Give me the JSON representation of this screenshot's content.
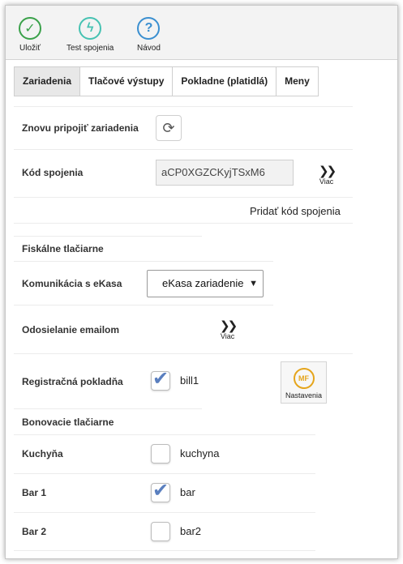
{
  "toolbar": {
    "save_label": "Uložiť",
    "test_label": "Test spojenia",
    "help_label": "Návod"
  },
  "tabs": [
    {
      "label": "Zariadenia",
      "active": true
    },
    {
      "label": "Tlačové výstupy",
      "active": false
    },
    {
      "label": "Pokladne (platidlá)",
      "active": false
    },
    {
      "label": "Meny",
      "active": false
    }
  ],
  "devices": {
    "reconnect_label": "Znovu pripojiť zariadenia",
    "code_label": "Kód spojenia",
    "code_value": "aCP0XGZCKyjTSxM6",
    "more_label": "Viac",
    "add_code_label": "Pridať kód spojenia"
  },
  "fiscal": {
    "section_title": "Fiskálne tlačiarne",
    "ekasa_label": "Komunikácia s eKasa",
    "ekasa_selected": "eKasa zariadenie",
    "email_label": "Odosielanie emailom",
    "more_label": "Viac",
    "register_label": "Registračná pokladňa",
    "register_value": "bill1",
    "register_checked": true,
    "settings_label": "Nastavenia"
  },
  "kitchen_printers": {
    "section_title": "Bonovacie tlačiarne",
    "items": [
      {
        "label": "Kuchyňa",
        "value": "kuchyna",
        "checked": false
      },
      {
        "label": "Bar 1",
        "value": "bar",
        "checked": true
      },
      {
        "label": "Bar 2",
        "value": "bar2",
        "checked": false
      }
    ]
  },
  "colors": {
    "save": "#3aa14a",
    "test": "#46c2b2",
    "help": "#3a8fd0",
    "check": "#5a7fbf",
    "settings_logo": "#e5a51c"
  }
}
